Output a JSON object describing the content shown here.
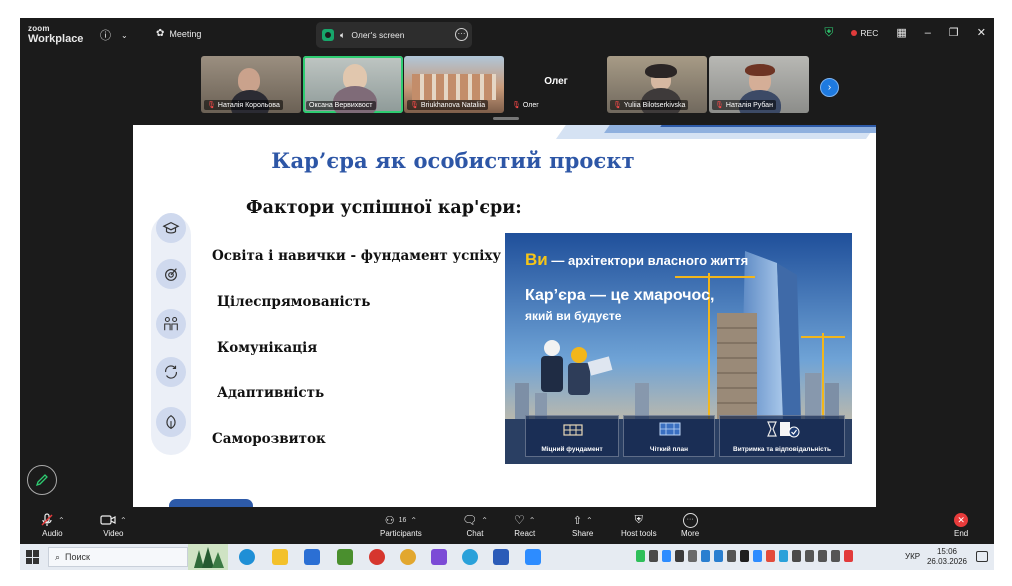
{
  "titlebar": {
    "brand_line1": "zoom",
    "brand_line2": "Workplace",
    "meeting_label": "Meeting",
    "screen_label": "Олег's screen",
    "rec_label": "REC"
  },
  "participants": [
    {
      "name": "Наталія Корольова",
      "muted": true
    },
    {
      "name": "Оксана Вервихвост",
      "muted": false,
      "active": true
    },
    {
      "name": "Briukhanova Nataliia",
      "muted": true
    },
    {
      "name": "Олег",
      "muted": true
    },
    {
      "name": "Yuliia Bilotserkivska",
      "muted": true
    },
    {
      "name": "Наталія Рубан",
      "muted": true
    }
  ],
  "oleg_tile_label": "Олег",
  "slide": {
    "title": "Кар’єра як особистий проєкт",
    "factors_heading": "Фактори успішної кар'єри:",
    "factors": [
      {
        "label": "Освіта і навички - фундамент успіху",
        "icon": "graduation-cap-icon"
      },
      {
        "label": "Цілеспрямованість",
        "icon": "target-icon"
      },
      {
        "label": "Комунікація",
        "icon": "people-icon"
      },
      {
        "label": "Адаптивність",
        "icon": "refresh-icon"
      },
      {
        "label": "Саморозвиток",
        "icon": "leaf-icon"
      }
    ],
    "poster": {
      "line1_strong": "Ви",
      "line1_rest": " — архітектори власного життя",
      "line2": "Кар’єра — це хмарочос,",
      "line3": "який ви будуєте",
      "cards": [
        "Міцний фундамент",
        "Чіткий план",
        "Витримка та відповідальність"
      ]
    }
  },
  "toolbar": {
    "audio": "Audio",
    "video": "Video",
    "participants": "Participants",
    "participants_count": "16",
    "chat": "Chat",
    "react": "React",
    "share": "Share",
    "host_tools": "Host tools",
    "more": "More",
    "end": "End"
  },
  "taskbar": {
    "search_placeholder": "Поиск",
    "language": "УКР",
    "time": "15:06",
    "date": "26.03.2026"
  },
  "colors": {
    "accent_blue": "#2d56a6",
    "zoom_green": "#2ecc71",
    "rec_red": "#e03b3b",
    "end_red": "#e83b3b"
  }
}
